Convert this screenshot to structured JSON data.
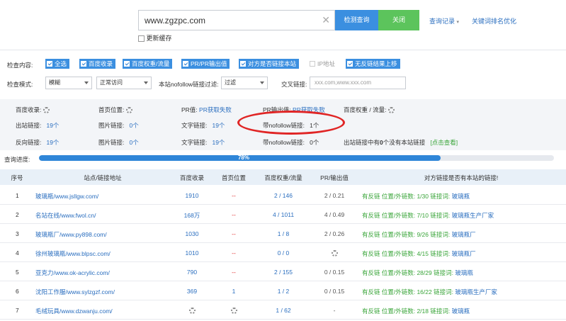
{
  "search": {
    "value": "www.zgzpc.com",
    "clear_icon": "close-icon"
  },
  "buttons": {
    "query": "检测查询",
    "close": "关闭"
  },
  "links": {
    "history": "查询记录",
    "keyword_rank": "关键词排名优化"
  },
  "cache_label": "更新缓存",
  "options": {
    "check_label": "检查内容:",
    "items": [
      {
        "label": "全选",
        "checked": true
      },
      {
        "label": "百度收录",
        "checked": true
      },
      {
        "label": "百度权重/流量",
        "checked": true
      },
      {
        "label": "PR/PR输出值",
        "checked": true
      },
      {
        "label": "对方是否链接本站",
        "checked": true
      },
      {
        "label": "IP地址",
        "checked": false
      },
      {
        "label": "无反链结果上移",
        "checked": true
      }
    ],
    "mode_label": "检查模式:",
    "mode_value": "模糊",
    "access_value": "正常访问",
    "nofollow_label": "本站nofollow链接过滤:",
    "nofollow_value": "过滤",
    "cross_label": "交叉链接:",
    "cross_placeholder": "xxx.com,www.xxx.com"
  },
  "stats": {
    "row1": {
      "baidu_label": "百度收录:",
      "home_label": "首页位置:",
      "pr_label": "PR值:",
      "pr_value": "PR获取失败",
      "pr_out_label": "PR输出值:",
      "pr_out_value": "PR获取失败",
      "weight_label": "百度权重 / 流量:"
    },
    "row2": {
      "out_label": "出站链接:",
      "out_value": "19个",
      "img_label": "图片链接:",
      "img_value": "0个",
      "text_label": "文字链接:",
      "text_value": "19个",
      "nofollow_label": "带nofollow链接:",
      "nofollow_value": "1个"
    },
    "row3": {
      "back_label": "反向链接:",
      "back_value": "19个",
      "img_label": "图片链接:",
      "img_value": "0个",
      "text_label": "文字链接:",
      "text_value": "19个",
      "nofollow_label": "带nofollow链接:",
      "nofollow_value": "0个",
      "missing_text_a": "出站链接中有",
      "missing_count": "0",
      "missing_text_b": "个没有本站链接",
      "view_link": "[点击查看]"
    }
  },
  "progress": {
    "label": "查询进度:",
    "percent": 78,
    "text": "78%"
  },
  "table": {
    "headers": [
      "序号",
      "站点/链接地址",
      "百度收录",
      "首页位置",
      "百度权重/流量",
      "PR/输出值",
      "对方链接是否有本站的链接!"
    ],
    "rows": [
      {
        "num": "1",
        "site": "玻璃瓶/www.jsllgw.com/",
        "baidu": "1910",
        "home": "--",
        "home_type": "red",
        "weight": "2 / 146",
        "pr": "2 / 0.21",
        "opp": "有反链 位置/外链数: 1/30 链接词: ",
        "kw": "玻璃瓶"
      },
      {
        "num": "2",
        "site": "名站在线/www.fwol.cn/",
        "baidu": "168万",
        "home": "--",
        "home_type": "red",
        "weight": "4 / 1011",
        "pr": "4 / 0.49",
        "opp": "有反链 位置/外链数: 7/10 链接词: ",
        "kw": "玻璃瓶生产厂家"
      },
      {
        "num": "3",
        "site": "玻璃瓶厂/www.py898.com/",
        "baidu": "1030",
        "home": "--",
        "home_type": "red",
        "weight": "1 / 8",
        "pr": "2 / 0.26",
        "opp": "有反链 位置/外链数: 9/26 链接词: ",
        "kw": "玻璃瓶厂"
      },
      {
        "num": "4",
        "site": "徐州玻璃瓶/www.blpsc.com/",
        "baidu": "1010",
        "home": "--",
        "home_type": "red",
        "weight": "0 / 0",
        "pr": "",
        "pr_spin": true,
        "opp": "有反链 位置/外链数: 4/15 链接词: ",
        "kw": "玻璃瓶厂"
      },
      {
        "num": "5",
        "site": "亚克力/www.ok-acrylic.com/",
        "baidu": "790",
        "home": "--",
        "home_type": "red",
        "weight": "2 / 155",
        "pr": "0 / 0.15",
        "opp": "有反链 位置/外链数: 28/29 链接词: ",
        "kw": "玻璃瓶"
      },
      {
        "num": "6",
        "site": "沈阳工作服/www.sylzgzf.com/",
        "baidu": "369",
        "home": "1",
        "home_type": "blue",
        "weight": "1 / 2",
        "pr": "0 / 0.15",
        "opp": "有反链 位置/外链数: 16/22 链接词: ",
        "kw": "玻璃瓶生产厂家"
      },
      {
        "num": "7",
        "site": "毛绒玩具/www.dzwanju.com/",
        "baidu": "",
        "baidu_spin": true,
        "home": "",
        "home_spin": true,
        "home_type": "red",
        "weight": "1 / 62",
        "pr": "-",
        "opp": "有反链 位置/外链数: 2/18 链接词: ",
        "kw": "玻璃瓶"
      }
    ]
  },
  "colors": {
    "accent": "#3b8fe0",
    "green": "#5cc45c",
    "highlight": "#e02525"
  }
}
